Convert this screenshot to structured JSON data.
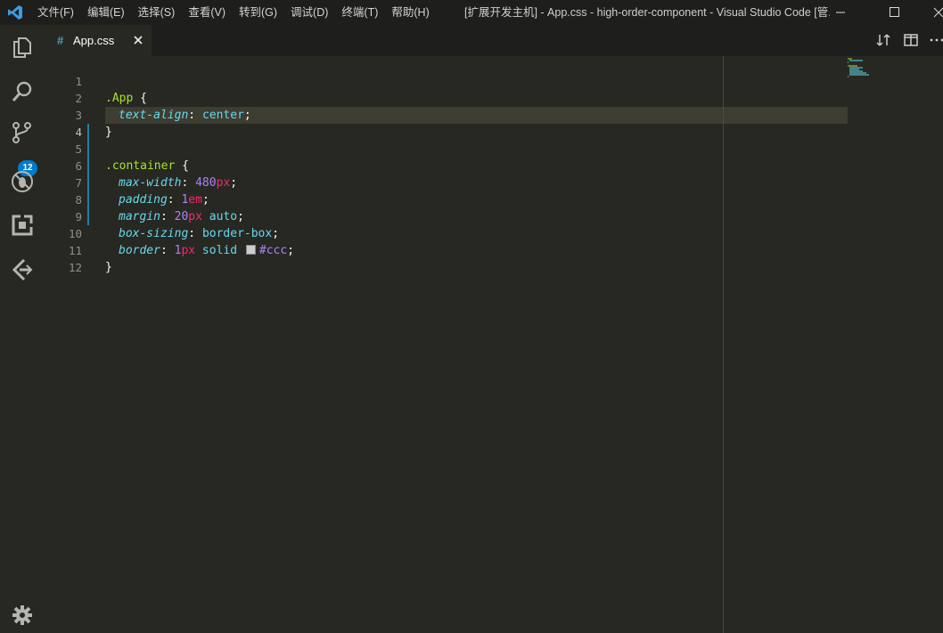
{
  "titlebar": {
    "menu": [
      "文件(F)",
      "编辑(E)",
      "选择(S)",
      "查看(V)",
      "转到(G)",
      "调试(D)",
      "终端(T)",
      "帮助(H)"
    ],
    "title": "[扩展开发主机] - App.css - high-order-component - Visual Studio Code [管..."
  },
  "activity_bar": {
    "items": [
      "files-icon",
      "search-icon",
      "source-control-icon",
      "debug-icon",
      "extensions-icon",
      "leetcode-icon"
    ],
    "scm_badge": "12",
    "settings": "gear-icon"
  },
  "tab": {
    "icon_text": "#",
    "label": "App.css",
    "close": "×"
  },
  "editor": {
    "line_numbers": [
      "1",
      "2",
      "3",
      "4",
      "5",
      "6",
      "7",
      "8",
      "9",
      "10",
      "11",
      "12"
    ],
    "current_line": "4",
    "code": {
      "l1_selector": ".App",
      "l1_brace": " {",
      "l2_prop": "text-align",
      "l2_colon": ": ",
      "l2_val": "center",
      "l2_semi": ";",
      "l3": "}",
      "l5_selector": ".container",
      "l5_brace": " {",
      "l6_prop": "max-width",
      "l6_num": "480",
      "l6_unit": "px",
      "l7_prop": "padding",
      "l7_num": "1",
      "l7_unit": "em",
      "l8_prop": "margin",
      "l8_num": "20",
      "l8_unit": "px",
      "l8_val": " auto",
      "l9_prop": "box-sizing",
      "l9_val": "border-box",
      "l10_prop": "border",
      "l10_num": "1",
      "l10_unit": "px",
      "l10_val": " solid",
      "l10_hex": "#ccc",
      "colon": ": ",
      "semi": ";",
      "l11": "}"
    }
  },
  "colors": {
    "background": "#272822",
    "titlebar": "#1e1f1c",
    "selector": "#a6e22e",
    "property": "#66d9ef",
    "number": "#ae81ff",
    "unit": "#f92672",
    "badge": "#007acc",
    "swatch": "#cccccc"
  }
}
